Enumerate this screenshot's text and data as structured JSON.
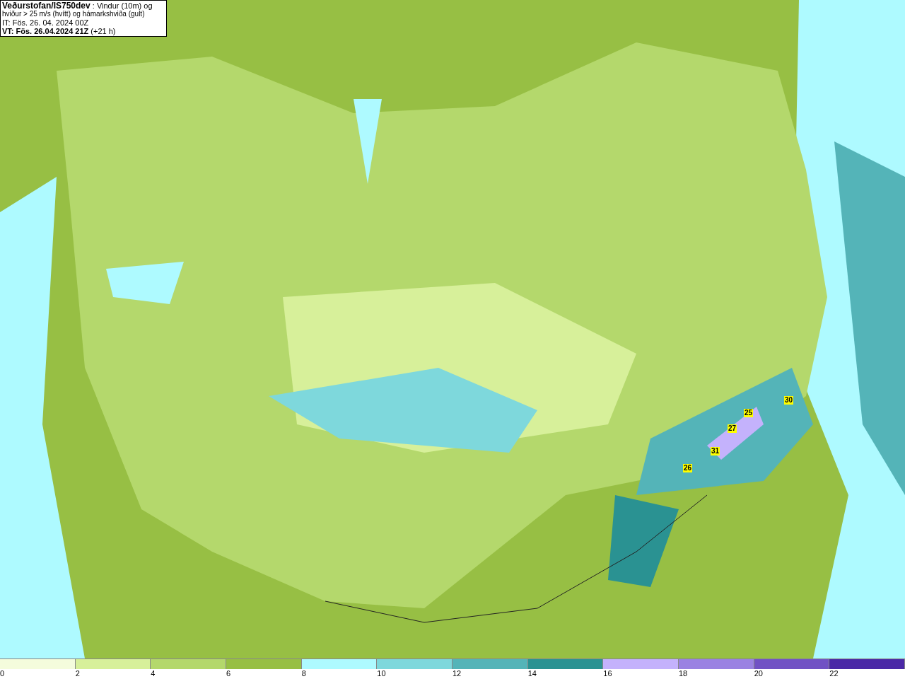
{
  "header": {
    "title": "Veðurstofan/IS750dev",
    "title_rest": " : Vindur (10m) og",
    "line_2": "hviður > 25 m/s (hvítt) og hámarkshviða (gult)",
    "line_3": "IT: Fös. 26. 04. 2024 00Z",
    "line_4": "VT: Fös. 26.04.2024 21Z",
    "line_4_rest": " (+21 h)"
  },
  "gust_labels": [
    {
      "value": "30"
    },
    {
      "value": "25"
    },
    {
      "value": "27"
    },
    {
      "value": "31"
    },
    {
      "value": "26"
    }
  ],
  "legend": [
    {
      "label": "0",
      "color": "#f4fcdc"
    },
    {
      "label": "2",
      "color": "#d7f09a"
    },
    {
      "label": "4",
      "color": "#b4d86c"
    },
    {
      "label": "6",
      "color": "#97bf44"
    },
    {
      "label": "8",
      "color": "#aefaff"
    },
    {
      "label": "10",
      "color": "#7ed8dc"
    },
    {
      "label": "12",
      "color": "#54b4b8"
    },
    {
      "label": "14",
      "color": "#2a9292"
    },
    {
      "label": "16",
      "color": "#c4b2fc"
    },
    {
      "label": "18",
      "color": "#9a82e2"
    },
    {
      "label": "20",
      "color": "#7152c4"
    },
    {
      "label": "22",
      "color": "#4a28a6"
    }
  ]
}
